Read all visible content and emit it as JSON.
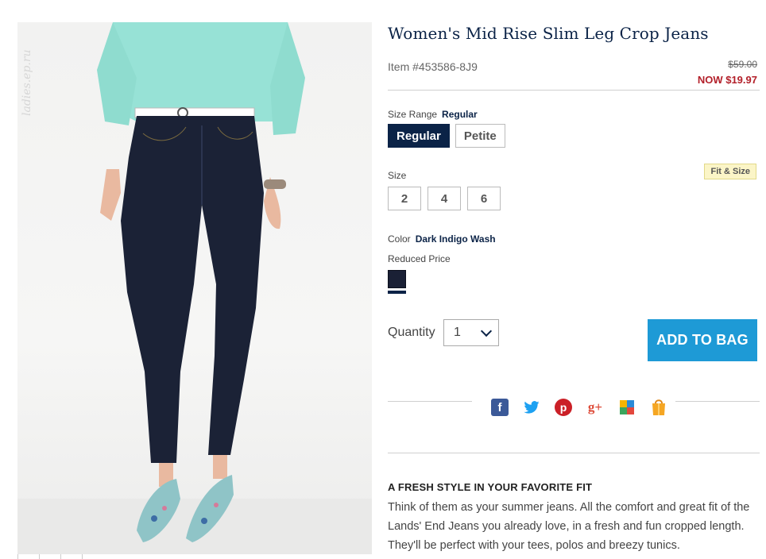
{
  "watermark": "ladies.ep.ru",
  "product": {
    "title": "Women's Mid Rise Slim Leg Crop Jeans",
    "item_number": "Item #453586-8J9",
    "old_price": "$59.00",
    "now_price": "NOW $19.97"
  },
  "size_range": {
    "label": "Size Range",
    "selected": "Regular",
    "options": [
      "Regular",
      "Petite"
    ]
  },
  "size": {
    "label": "Size",
    "fit_link": "Fit & Size",
    "options": [
      "2",
      "4",
      "6"
    ]
  },
  "color": {
    "label": "Color",
    "selected": "Dark Indigo Wash",
    "reduced_label": "Reduced Price",
    "swatch_color": "#1a2035"
  },
  "quantity": {
    "label": "Quantity",
    "value": "1"
  },
  "add_to_bag": "ADD TO BAG",
  "share_icons": [
    "facebook-icon",
    "twitter-icon",
    "pinterest-icon",
    "google-plus-icon",
    "multi-square-icon",
    "shopping-bag-icon"
  ],
  "description": {
    "heading": "A FRESH STYLE IN YOUR FAVORITE FIT",
    "body": "Think of them as your summer jeans. All the comfort and great fit of the Lands' End Jeans you already love, in a fresh and fun cropped length. They'll be perfect with your tees, polos and breezy tunics."
  },
  "colors": {
    "navy": "#0b2347",
    "sale_red": "#b3202a",
    "cta_blue": "#1e9ad6"
  }
}
